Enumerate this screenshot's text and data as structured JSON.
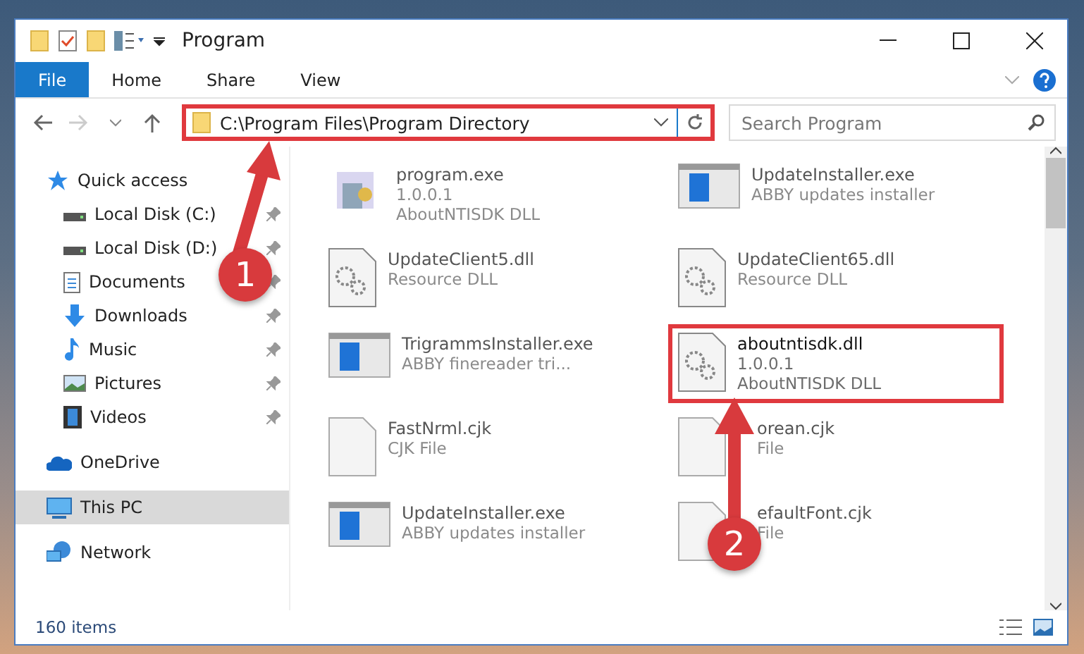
{
  "window": {
    "title": "Program"
  },
  "ribbon_tabs": [
    {
      "label": "File",
      "selected": true
    },
    {
      "label": "Home",
      "selected": false
    },
    {
      "label": "Share",
      "selected": false
    },
    {
      "label": "View",
      "selected": false
    }
  ],
  "address_bar": {
    "path": "C:\\Program Files\\Program Directory",
    "highlighted": true
  },
  "search": {
    "placeholder": "Search Program"
  },
  "sidebar": {
    "items": [
      {
        "label": "Quick access",
        "kind": "star",
        "pinned": false,
        "selected": false,
        "children": [
          {
            "label": "Local Disk (C:)",
            "kind": "disk",
            "pinned": true,
            "selected": false
          },
          {
            "label": "Local Disk (D:)",
            "kind": "disk",
            "pinned": true,
            "selected": false
          },
          {
            "label": "Documents",
            "kind": "document",
            "pinned": true,
            "selected": false
          },
          {
            "label": "Downloads",
            "kind": "download",
            "pinned": true,
            "selected": false
          },
          {
            "label": "Music",
            "kind": "music",
            "pinned": true,
            "selected": false
          },
          {
            "label": "Pictures",
            "kind": "pictures",
            "pinned": true,
            "selected": false
          },
          {
            "label": "Videos",
            "kind": "videos",
            "pinned": true,
            "selected": false
          }
        ]
      },
      {
        "label": "OneDrive",
        "kind": "cloud",
        "pinned": false,
        "selected": false
      },
      {
        "label": "This PC",
        "kind": "computer",
        "pinned": false,
        "selected": true
      },
      {
        "label": "Network",
        "kind": "network",
        "pinned": false,
        "selected": false
      }
    ]
  },
  "files": [
    {
      "name": "program.exe",
      "details": [
        "1.0.0.1",
        "AboutNTISDK DLL"
      ],
      "kind": "program",
      "highlighted": false
    },
    {
      "name": "UpdateInstaller.exe",
      "details": [
        "ABBY updates installer"
      ],
      "kind": "window",
      "highlighted": false
    },
    {
      "name": "UpdateClient5.dll",
      "details": [
        "Resource DLL"
      ],
      "kind": "dll",
      "highlighted": false
    },
    {
      "name": "UpdateClient65.dll",
      "details": [
        "Resource DLL"
      ],
      "kind": "dll",
      "highlighted": false
    },
    {
      "name": "TrigrammsInstaller.exe",
      "details": [
        "ABBY finereader tri..."
      ],
      "kind": "window",
      "highlighted": false
    },
    {
      "name": "aboutntisdk.dll",
      "details": [
        "1.0.0.1",
        "AboutNTISDK DLL"
      ],
      "kind": "dll",
      "highlighted": true
    },
    {
      "name": "FastNrml.cjk",
      "details": [
        "CJK File"
      ],
      "kind": "blank",
      "highlighted": false
    },
    {
      "name": "orean.cjk",
      "details": [
        "File"
      ],
      "kind": "blank",
      "highlighted": false
    },
    {
      "name": "UpdateInstaller.exe",
      "details": [
        "ABBY updates installer"
      ],
      "kind": "window",
      "highlighted": false
    },
    {
      "name": "efaultFont.cjk",
      "details": [
        "File"
      ],
      "kind": "blank",
      "highlighted": false
    }
  ],
  "status_bar": {
    "count": "160 items"
  },
  "annotations": [
    {
      "number": "1"
    },
    {
      "number": "2"
    }
  ]
}
